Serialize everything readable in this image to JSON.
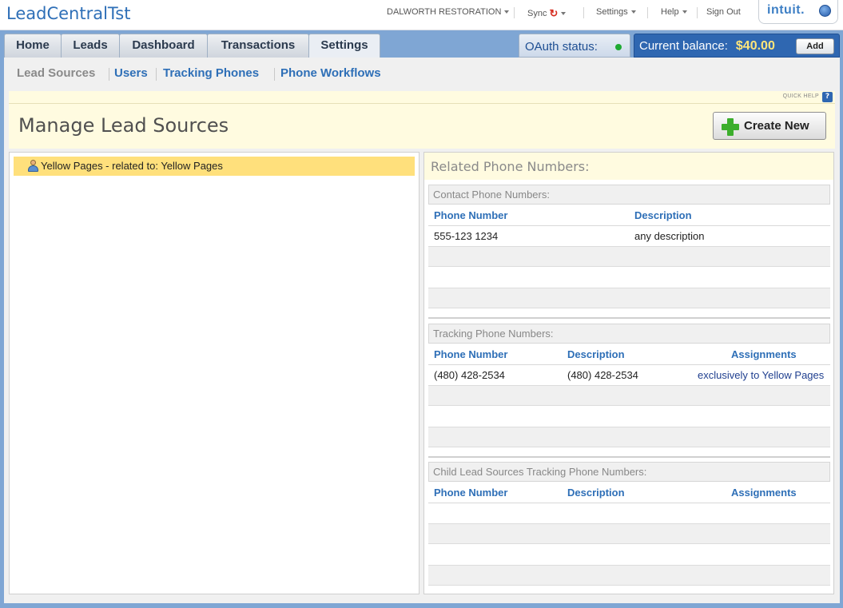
{
  "app": {
    "title": "LeadCentralTst"
  },
  "topnav": {
    "account": "DALWORTH RESTORATION",
    "sync": "Sync",
    "settings": "Settings",
    "help": "Help",
    "sign_out": "Sign Out",
    "intuit": "intuit."
  },
  "tabs": [
    "Home",
    "Leads",
    "Dashboard",
    "Transactions",
    "Settings"
  ],
  "active_tab": "Settings",
  "oauth": {
    "label": "OAuth status:",
    "status_color": "#1faa33"
  },
  "balance": {
    "label": "Current balance:",
    "amount": "$40.00",
    "add": "Add"
  },
  "subnav": [
    "Lead Sources",
    "Users",
    "Tracking Phones",
    "Phone Workflows"
  ],
  "quick_help": {
    "label": "QUICK HELP",
    "icon": "?"
  },
  "page": {
    "title": "Manage Lead Sources",
    "create_button": "Create New"
  },
  "tree": {
    "items": [
      {
        "label": "Yellow Pages - related to: Yellow Pages"
      }
    ]
  },
  "related": {
    "title": "Related Phone Numbers:",
    "contact": {
      "title": "Contact Phone Numbers:",
      "headers": [
        "Phone Number",
        "Description"
      ],
      "rows": [
        [
          "555-123 1234",
          "any description"
        ]
      ]
    },
    "tracking": {
      "title": "Tracking Phone Numbers:",
      "headers": [
        "Phone Number",
        "Description",
        "Assignments"
      ],
      "rows": [
        [
          "(480) 428-2534",
          "(480) 428-2534",
          "exclusively to Yellow Pages"
        ]
      ]
    },
    "child": {
      "title": "Child Lead Sources Tracking Phone Numbers:",
      "headers": [
        "Phone Number",
        "Description",
        "Assignments"
      ],
      "rows": []
    }
  }
}
